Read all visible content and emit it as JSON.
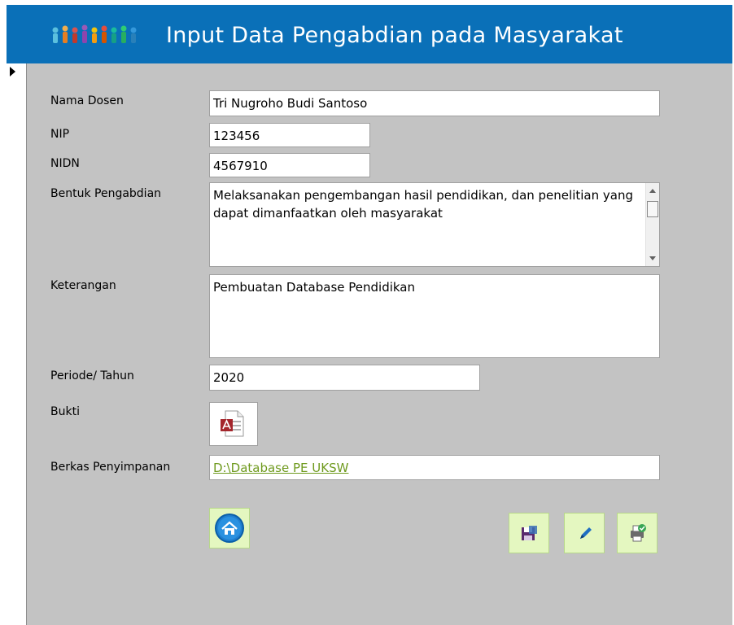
{
  "header": {
    "title": "Input Data Pengabdian pada  Masyarakat",
    "logo": "people-group-logo"
  },
  "fields": {
    "nama_dosen": {
      "label": "Nama Dosen",
      "value": "Tri Nugroho Budi Santoso"
    },
    "nip": {
      "label": "NIP",
      "value": "123456"
    },
    "nidn": {
      "label": "NIDN",
      "value": "4567910"
    },
    "bentuk": {
      "label": "Bentuk Pengabdian",
      "value": "Melaksanakan pengembangan hasil pendidikan, dan penelitian yang dapat dimanfaatkan oleh masyarakat"
    },
    "keterangan": {
      "label": "Keterangan",
      "value": "Pembuatan Database Pendidikan"
    },
    "periode": {
      "label": "Periode/ Tahun",
      "value": "2020"
    },
    "bukti": {
      "label": "Bukti",
      "icon": "access-file-icon"
    },
    "berkas": {
      "label": "Berkas Penyimpanan",
      "value": "D:\\Database PE UKSW"
    }
  },
  "buttons": {
    "home": "home-icon",
    "save": "save-icon",
    "edit": "pencil-icon",
    "print": "print-icon"
  },
  "colors": {
    "header_bg": "#0a70b8",
    "form_bg": "#c3c3c3",
    "button_bg": "#e4f7c0",
    "link": "#6f9a1e"
  }
}
